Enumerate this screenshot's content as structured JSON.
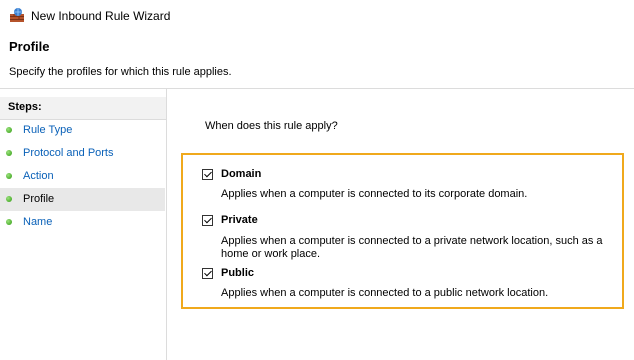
{
  "window": {
    "title": "New Inbound Rule Wizard",
    "icon": "firewall-icon"
  },
  "header": {
    "title": "Profile",
    "subtitle": "Specify the profiles for which this rule applies."
  },
  "sidebar": {
    "steps_label": "Steps:",
    "items": [
      {
        "label": "Rule Type"
      },
      {
        "label": "Protocol and Ports"
      },
      {
        "label": "Action"
      },
      {
        "label": "Profile"
      },
      {
        "label": "Name"
      }
    ],
    "current": "Profile"
  },
  "main": {
    "question": "When does this rule apply?",
    "options": [
      {
        "name": "Domain",
        "checked": true,
        "description": "Applies when a computer is connected to its corporate domain."
      },
      {
        "name": "Private",
        "checked": true,
        "description": "Applies when a computer is connected to a private network location, such as a home or work place."
      },
      {
        "name": "Public",
        "checked": true,
        "description": "Applies when a computer is connected to a public network location."
      }
    ]
  },
  "colors": {
    "highlight": "#f0a91c",
    "link": "#0a61b8",
    "step_dot": "#2e9a0f"
  }
}
